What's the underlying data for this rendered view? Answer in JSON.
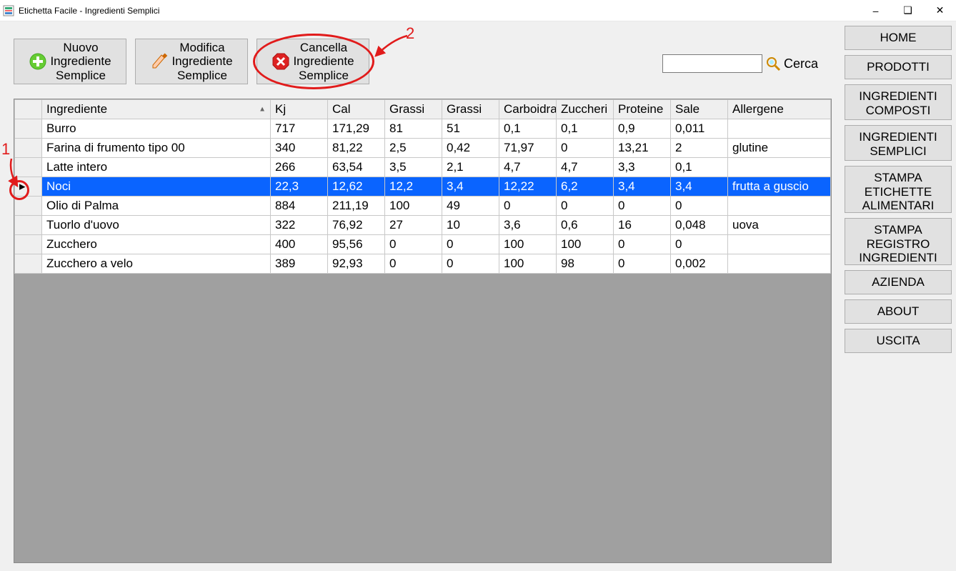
{
  "window": {
    "title": "Etichetta Facile - Ingredienti Semplici"
  },
  "toolbar": {
    "new_label": "Nuovo\nIngrediente\nSemplice",
    "modify_label": "Modifica\nIngrediente\nSemplice",
    "delete_label": "Cancella\nIngrediente\nSemplice"
  },
  "search": {
    "label": "Cerca",
    "value": ""
  },
  "table": {
    "columns": [
      "Ingrediente",
      "Kj",
      "Cal",
      "Grassi",
      "Grassi",
      "Carboidra",
      "Zuccheri",
      "Proteine",
      "Sale",
      "Allergene"
    ],
    "sort_column_index": 0,
    "rows": [
      {
        "ingredient": "Burro",
        "kj": "717",
        "cal": "171,29",
        "grassi": "81",
        "grassi2": "51",
        "carb": "0,1",
        "zucc": "0,1",
        "prot": "0,9",
        "sale": "0,011",
        "allerg": ""
      },
      {
        "ingredient": "Farina di frumento tipo 00",
        "kj": "340",
        "cal": "81,22",
        "grassi": "2,5",
        "grassi2": "0,42",
        "carb": "71,97",
        "zucc": "0",
        "prot": "13,21",
        "sale": "2",
        "allerg": "glutine"
      },
      {
        "ingredient": "Latte intero",
        "kj": "266",
        "cal": "63,54",
        "grassi": "3,5",
        "grassi2": "2,1",
        "carb": "4,7",
        "zucc": "4,7",
        "prot": "3,3",
        "sale": "0,1",
        "allerg": ""
      },
      {
        "ingredient": "Noci",
        "kj": "22,3",
        "cal": "12,62",
        "grassi": "12,2",
        "grassi2": "3,4",
        "carb": "12,22",
        "zucc": "6,2",
        "prot": "3,4",
        "sale": "3,4",
        "allerg": "frutta a guscio",
        "selected": true
      },
      {
        "ingredient": "Olio di Palma",
        "kj": "884",
        "cal": "211,19",
        "grassi": "100",
        "grassi2": "49",
        "carb": "0",
        "zucc": "0",
        "prot": "0",
        "sale": "0",
        "allerg": ""
      },
      {
        "ingredient": "Tuorlo d'uovo",
        "kj": "322",
        "cal": "76,92",
        "grassi": "27",
        "grassi2": "10",
        "carb": "3,6",
        "zucc": "0,6",
        "prot": "16",
        "sale": "0,048",
        "allerg": "uova"
      },
      {
        "ingredient": "Zucchero",
        "kj": "400",
        "cal": "95,56",
        "grassi": "0",
        "grassi2": "0",
        "carb": "100",
        "zucc": "100",
        "prot": "0",
        "sale": "0",
        "allerg": ""
      },
      {
        "ingredient": "Zucchero a velo",
        "kj": "389",
        "cal": "92,93",
        "grassi": "0",
        "grassi2": "0",
        "carb": "100",
        "zucc": "98",
        "prot": "0",
        "sale": "0,002",
        "allerg": ""
      }
    ]
  },
  "nav": {
    "home": "HOME",
    "prodotti": "PRODOTTI",
    "ing_comp": "INGREDIENTI\nCOMPOSTI",
    "ing_semp": "INGREDIENTI\nSEMPLICI",
    "stampa_et": "STAMPA\nETICHETTE\nALIMENTARI",
    "stampa_reg": "STAMPA\nREGISTRO\nINGREDIENTI",
    "azienda": "AZIENDA",
    "about": "ABOUT",
    "uscita": "USCITA"
  },
  "annotations": {
    "one": "1",
    "two": "2"
  }
}
